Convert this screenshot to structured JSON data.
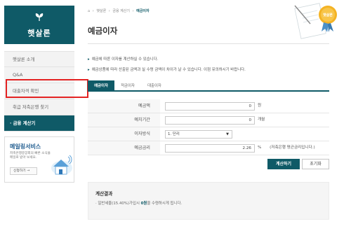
{
  "brand": {
    "name": "햇살론",
    "color": "#0f5a67"
  },
  "sidebar": {
    "items": [
      {
        "label": "햇살론 소개"
      },
      {
        "label": "Q&A"
      },
      {
        "label": "대출자격 확인"
      },
      {
        "label": "취급 저축은행 찾기"
      },
      {
        "label": "· 금융 계산기"
      }
    ],
    "promo": {
      "title": "메일링서비스",
      "description": "저축은행중앙회의 빠른 소식을 메일로 받아 보세요.",
      "button_label": "신청하기 →"
    }
  },
  "header": {
    "breadcrumbs": [
      "햇살론",
      "금융 계산기",
      "예금이자"
    ],
    "title": "예금이자",
    "badge": "햇살론"
  },
  "notes": [
    "예금에 따른 이자를 계산하실 수 있습니다.",
    "예금상품에 따라 산출된 금액과 실 수령 금액이 차이가 날 수 있습니다. 이점 유의하시기 바랍니다."
  ],
  "tabs": [
    {
      "label": "예금이자",
      "active": true
    },
    {
      "label": "적금이자",
      "active": false
    },
    {
      "label": "대출이자",
      "active": false
    }
  ],
  "form": {
    "deposit_label": "예금액",
    "deposit_value": "0",
    "deposit_unit": "원",
    "period_label": "예치기간",
    "period_value": "0",
    "period_unit": "개월",
    "method_label": "이자방식",
    "method_value": "1. 단리",
    "rate_label": "예금금리",
    "rate_value": "2.26",
    "rate_unit": "%",
    "rate_note": "(저축은행 평균금리입니다.)"
  },
  "buttons": {
    "calculate": "계산하기",
    "reset": "초기화"
  },
  "result": {
    "title": "계산결과",
    "prefix": "· 일반세율(15.40%)가입시 ",
    "amount": "0원",
    "suffix": "을 수령하시게 됩니다."
  }
}
